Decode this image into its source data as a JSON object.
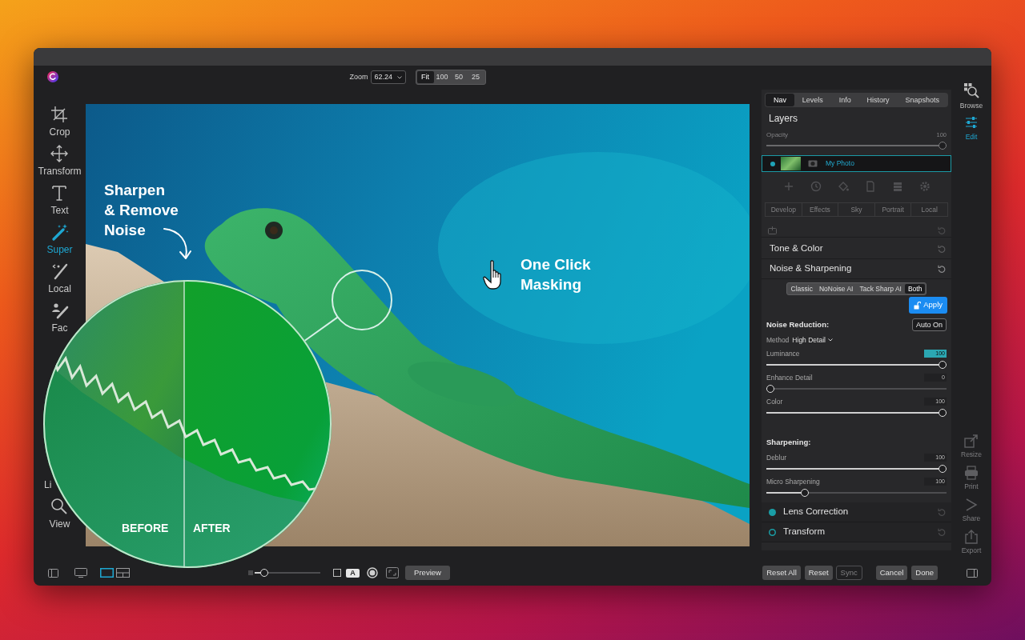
{
  "toolbar": {
    "zoom_label": "Zoom",
    "zoom_value": "62.24",
    "zoom_presets": [
      {
        "label": "Fit",
        "selected": true
      },
      {
        "label": "100",
        "selected": false
      },
      {
        "label": "50",
        "selected": false
      },
      {
        "label": "25",
        "selected": false
      }
    ]
  },
  "tools": [
    {
      "label": "Crop",
      "selected": false
    },
    {
      "label": "Transform",
      "selected": false
    },
    {
      "label": "Text",
      "selected": false
    },
    {
      "label": "Super",
      "selected": true
    },
    {
      "label": "Local",
      "selected": false
    },
    {
      "label": "Fac",
      "selected": false
    }
  ],
  "tools_bottom": [
    {
      "label": "Li",
      "kind": "covered",
      "selected": false
    },
    {
      "label": "View",
      "kind": "tool",
      "selected": false
    }
  ],
  "canvas": {
    "callouts": [
      {
        "lines": [
          "Sharpen",
          "& Remove",
          "Noise"
        ]
      },
      {
        "lines": [
          "One Click",
          "Masking"
        ]
      }
    ],
    "compare_labels": [
      "BEFORE",
      "AFTER"
    ]
  },
  "panel": {
    "tabs": [
      {
        "label": "Nav",
        "selected": true
      },
      {
        "label": "Levels",
        "selected": false
      },
      {
        "label": "Info",
        "selected": false
      },
      {
        "label": "History",
        "selected": false
      },
      {
        "label": "Snapshots",
        "selected": false
      }
    ],
    "layers_title": "Layers",
    "opacity": {
      "label": "Opacity",
      "value": "100",
      "level": 1,
      "disabled": true
    },
    "layer": {
      "name": "My Photo",
      "selected": true
    },
    "filter_tabs": [
      {
        "label": "Develop",
        "disabled": true
      },
      {
        "label": "Effects",
        "disabled": true
      },
      {
        "label": "Sky",
        "disabled": true
      },
      {
        "label": "Portrait",
        "disabled": true
      },
      {
        "label": "Local",
        "disabled": true
      }
    ],
    "sections": [
      {
        "title": "Tone & Color"
      },
      {
        "title": "Noise & Sharpening"
      }
    ],
    "modes": [
      {
        "label": "Classic",
        "selected": false
      },
      {
        "label": "NoNoise AI",
        "selected": false
      },
      {
        "label": "Tack Sharp AI",
        "selected": false
      },
      {
        "label": "Both",
        "selected": true
      }
    ],
    "apply_button": "Apply",
    "noise_reduction": {
      "title": "Noise Reduction:",
      "auto_button": "Auto On",
      "method_label": "Method",
      "method_value": "High Detail",
      "sliders": [
        {
          "label": "Luminance",
          "value": "100",
          "level": 1,
          "selected": true
        },
        {
          "label": "Enhance Detail",
          "value": "0",
          "level": 0,
          "selected": false
        },
        {
          "label": "Color",
          "value": "100",
          "level": 1,
          "selected": false
        }
      ]
    },
    "sharpening": {
      "title": "Sharpening:",
      "sliders": [
        {
          "label": "Deblur",
          "value": "100",
          "level": 1,
          "selected": false
        },
        {
          "label": "Micro Sharpening",
          "value": "100",
          "level": 0.2,
          "selected": false
        }
      ]
    },
    "modules": [
      {
        "title": "Lens Correction",
        "on": true
      },
      {
        "title": "Transform",
        "on": false
      }
    ]
  },
  "side_nav": {
    "top": [
      {
        "label": "Browse",
        "selected": false
      },
      {
        "label": "Edit",
        "selected": true
      }
    ],
    "bottom": [
      {
        "label": "Resize",
        "disabled": true
      },
      {
        "label": "Print",
        "disabled": true
      },
      {
        "label": "Share",
        "disabled": true
      },
      {
        "label": "Export",
        "disabled": true
      }
    ]
  },
  "bottom_bar": {
    "layouts": [
      {
        "selected": true
      },
      {
        "selected": false
      }
    ],
    "size_slider": {
      "level": 0.1
    },
    "overlay_letter": "A",
    "preview_button": "Preview",
    "buttons": [
      {
        "label": "Reset All",
        "disabled": false
      },
      {
        "label": "Reset",
        "disabled": false
      },
      {
        "label": "Sync",
        "disabled": true
      },
      {
        "label": "Cancel",
        "disabled": false
      },
      {
        "label": "Done",
        "disabled": false
      }
    ]
  }
}
